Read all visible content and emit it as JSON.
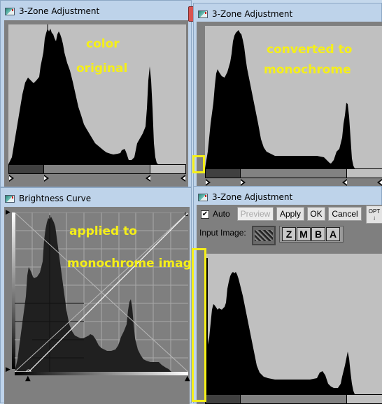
{
  "windows": {
    "top_left": {
      "title": "3-Zone Adjustment",
      "annotation_lines": [
        "color",
        "original"
      ]
    },
    "top_right": {
      "title": "3-Zone Adjustment",
      "annotation_lines": [
        "converted to",
        "monochrome"
      ]
    },
    "bottom_left": {
      "title": "Brightness Curve",
      "annotation_lines": [
        "applied to",
        "monochrome image"
      ]
    },
    "bottom_right": {
      "title": "3-Zone Adjustment",
      "auto_label": "Auto",
      "auto_checked": true,
      "check_glyph": "✔",
      "buttons": {
        "preview": "Preview",
        "apply": "Apply",
        "ok": "OK",
        "cancel": "Cancel",
        "options": "OPT"
      },
      "input_image_label": "Input Image:",
      "mode_buttons": [
        "Z",
        "M",
        "B",
        "A"
      ]
    }
  },
  "icons": {
    "window": "app-window-icon",
    "close": "close-icon",
    "arrow_down": "↓",
    "arrow_right": "➜",
    "arrow_up": "⬆"
  },
  "colors": {
    "annotation": "#f5ef18",
    "histogram_bg": "#c0c0c0",
    "histogram_fill": "#000000",
    "curve_bg": "#7f7f7f"
  }
}
